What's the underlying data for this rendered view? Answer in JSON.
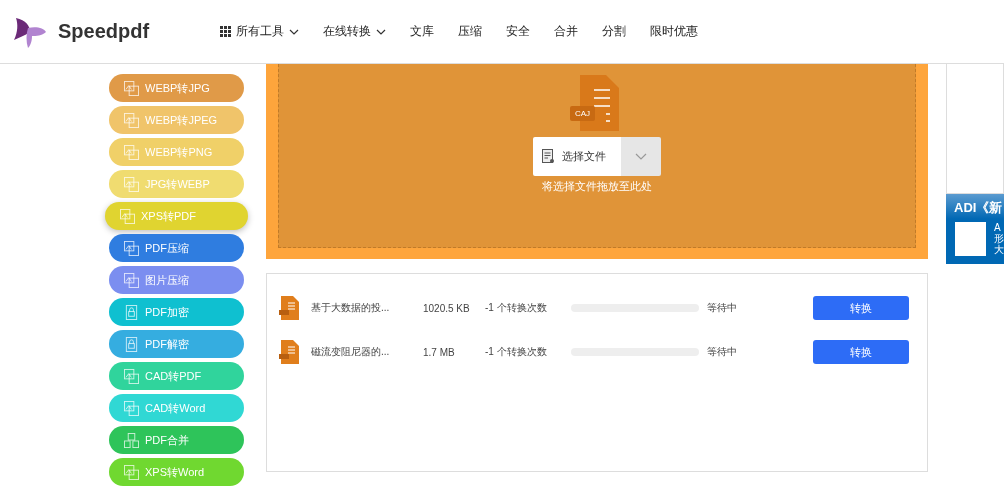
{
  "brand": "Speedpdf",
  "nav": [
    {
      "label": "所有工具",
      "kind": "grid-menu"
    },
    {
      "label": "在线转换",
      "kind": "menu"
    },
    {
      "label": "文库",
      "kind": "link"
    },
    {
      "label": "压缩",
      "kind": "link"
    },
    {
      "label": "安全",
      "kind": "link"
    },
    {
      "label": "合并",
      "kind": "link"
    },
    {
      "label": "分割",
      "kind": "link"
    },
    {
      "label": "限时优惠",
      "kind": "link"
    }
  ],
  "tools": [
    {
      "label": "WEBP转JPG",
      "color": "#e09a48",
      "selected": false,
      "kind": "image"
    },
    {
      "label": "WEBP转JPEG",
      "color": "#f0c46a",
      "selected": false,
      "kind": "image"
    },
    {
      "label": "WEBP转PNG",
      "color": "#f0d068",
      "selected": false,
      "kind": "image"
    },
    {
      "label": "JPG转WEBP",
      "color": "#f0dc70",
      "selected": false,
      "kind": "image"
    },
    {
      "label": "XPS转PDF",
      "color": "#e0d430",
      "selected": true,
      "kind": "image"
    },
    {
      "label": "PDF压缩",
      "color": "#2f7de0",
      "selected": false,
      "kind": "compress"
    },
    {
      "label": "图片压缩",
      "color": "#7b8ef0",
      "selected": false,
      "kind": "compress"
    },
    {
      "label": "PDF加密",
      "color": "#0fc0d0",
      "selected": false,
      "kind": "lock"
    },
    {
      "label": "PDF解密",
      "color": "#35ade0",
      "selected": false,
      "kind": "lock"
    },
    {
      "label": "CAD转PDF",
      "color": "#30d49c",
      "selected": false,
      "kind": "cad"
    },
    {
      "label": "CAD转Word",
      "color": "#30d8d4",
      "selected": false,
      "kind": "cad"
    },
    {
      "label": "PDF合并",
      "color": "#2ec45a",
      "selected": false,
      "kind": "merge"
    },
    {
      "label": "XPS转Word",
      "color": "#70d830",
      "selected": false,
      "kind": "image"
    }
  ],
  "upload": {
    "file_type": "CAJ",
    "button": "选择文件",
    "hint": "将选择文件拖放至此处"
  },
  "files": [
    {
      "name": "基于大数据的投...",
      "size": "1020.5 KB",
      "count": "-1 个转换次数",
      "level": 0,
      "status": "等待中",
      "action": "转换"
    },
    {
      "name": "磁流变阻尼器的...",
      "size": "1.7 MB",
      "count": "-1 个转换次数",
      "level": 0,
      "status": "等待中",
      "action": "转换"
    }
  ],
  "ad": {
    "title": "ADI《新",
    "lines": [
      "A",
      "形",
      "大"
    ]
  }
}
